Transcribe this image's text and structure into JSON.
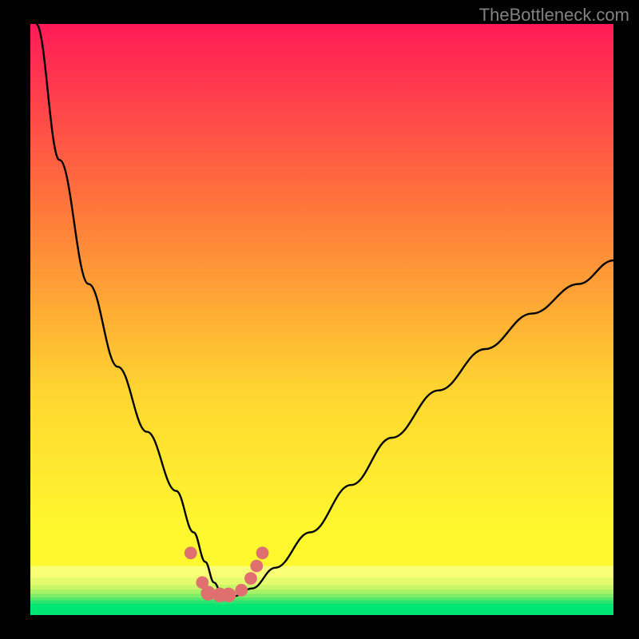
{
  "watermark": "TheBottleneck.com",
  "chart_data": {
    "type": "line",
    "title": "",
    "xlabel": "",
    "ylabel": "",
    "xlim": [
      0,
      100
    ],
    "ylim": [
      0,
      100
    ],
    "background_gradient": {
      "top": "#ff1a57",
      "mid1": "#ff7a3a",
      "mid2": "#ffd531",
      "mid3": "#fff82e",
      "bottom": "#00e574"
    },
    "series": [
      {
        "name": "bottleneck-curve",
        "x": [
          1,
          5,
          10,
          15,
          20,
          25,
          28,
          30,
          31.5,
          33,
          35,
          38,
          42,
          48,
          55,
          62,
          70,
          78,
          86,
          94,
          100
        ],
        "y": [
          100,
          77,
          56,
          42,
          31,
          21,
          14,
          9,
          5.5,
          3.2,
          3.2,
          4.5,
          8,
          14,
          22,
          30,
          38,
          45,
          51,
          56,
          60
        ]
      }
    ],
    "markers": [
      {
        "x": 27.5,
        "y": 10.5,
        "r": 1.2
      },
      {
        "x": 29.5,
        "y": 5.5,
        "r": 1.2
      },
      {
        "x": 30.5,
        "y": 3.7,
        "r": 1.4
      },
      {
        "x": 32.5,
        "y": 3.4,
        "r": 1.4
      },
      {
        "x": 34.0,
        "y": 3.4,
        "r": 1.4
      },
      {
        "x": 36.2,
        "y": 4.2,
        "r": 1.2
      },
      {
        "x": 37.8,
        "y": 6.2,
        "r": 1.2
      },
      {
        "x": 38.8,
        "y": 8.3,
        "r": 1.2
      },
      {
        "x": 39.8,
        "y": 10.5,
        "r": 1.2
      }
    ],
    "bottom_bands": [
      {
        "y": 6.3,
        "h": 2.0,
        "color": "#f8ff77"
      },
      {
        "y": 5.1,
        "h": 1.2,
        "color": "#e4fb6f"
      },
      {
        "y": 4.3,
        "h": 0.8,
        "color": "#c8f76a"
      },
      {
        "y": 3.6,
        "h": 0.7,
        "color": "#a5f168"
      },
      {
        "y": 3.0,
        "h": 0.6,
        "color": "#7dec68"
      },
      {
        "y": 2.5,
        "h": 0.5,
        "color": "#55e76b"
      },
      {
        "y": 2.0,
        "h": 0.5,
        "color": "#2ee371"
      },
      {
        "y": 0.0,
        "h": 2.0,
        "color": "#00e574"
      }
    ]
  }
}
